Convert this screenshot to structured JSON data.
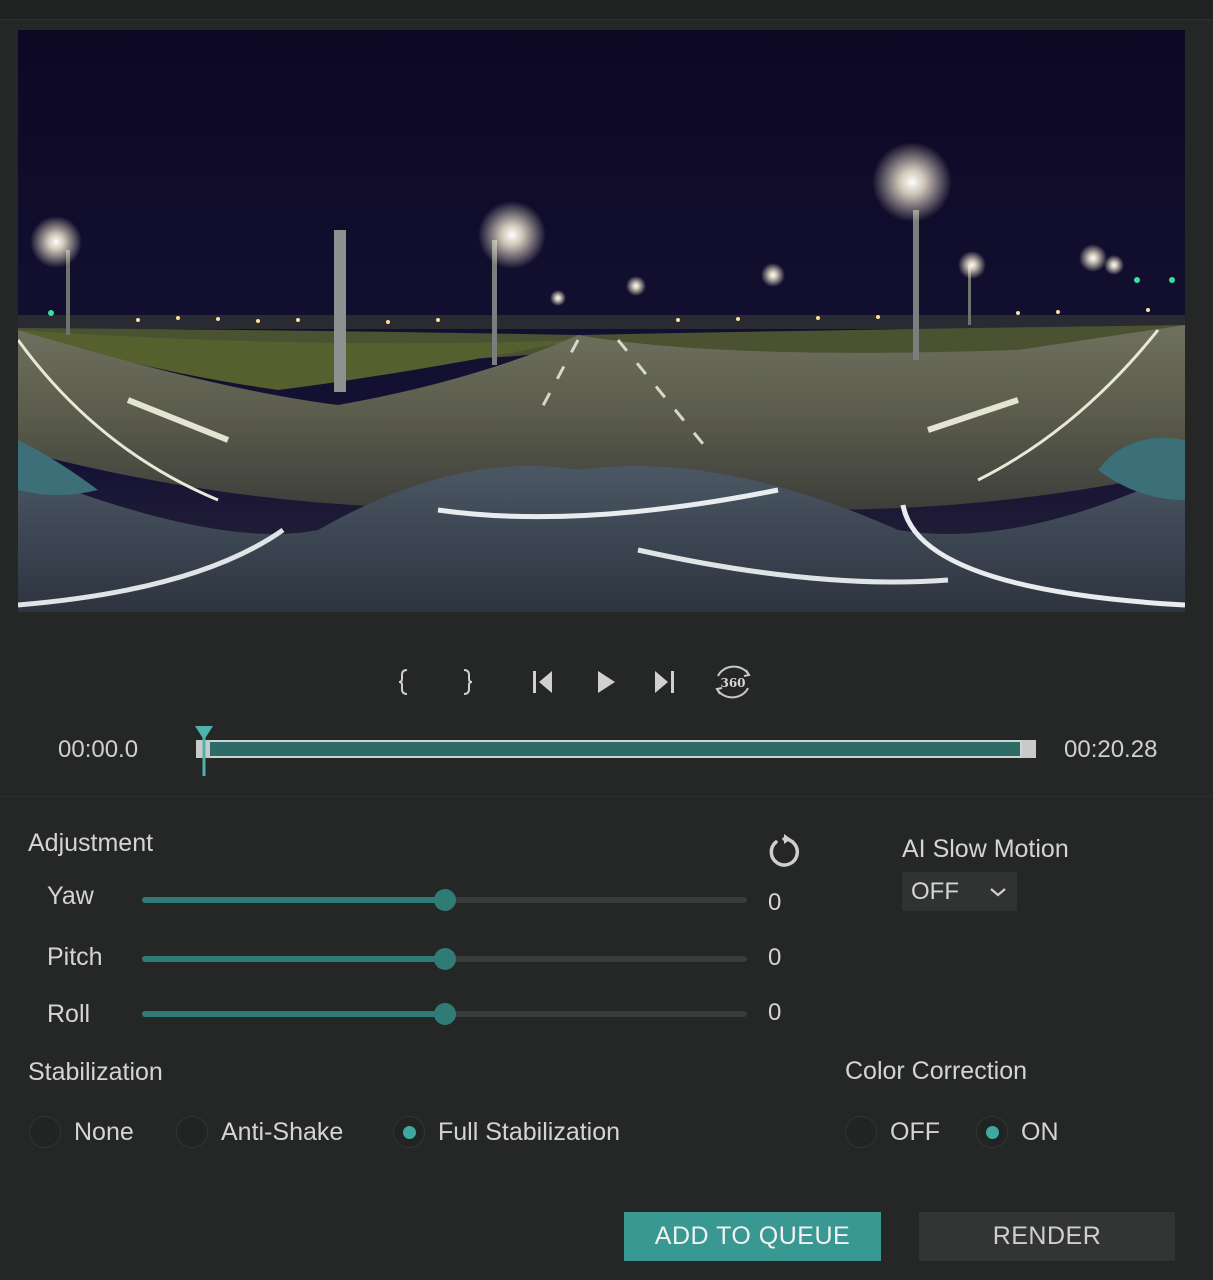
{
  "timeline": {
    "start_time": "00:00.0",
    "end_time": "00:20.28",
    "playhead_position": 0.01
  },
  "controls": {
    "icons": [
      "mark-in-icon",
      "mark-out-icon",
      "skip-back-icon",
      "play-icon",
      "skip-forward-icon",
      "view-360-icon"
    ],
    "view_360_label": "360"
  },
  "adjustment": {
    "title": "Adjustment",
    "sliders": [
      {
        "label": "Yaw",
        "value": "0",
        "level": 0.5
      },
      {
        "label": "Pitch",
        "value": "0",
        "level": 0.5
      },
      {
        "label": "Roll",
        "value": "0",
        "level": 0.5
      }
    ]
  },
  "ai_slow_motion": {
    "title": "AI Slow Motion",
    "selected": "OFF"
  },
  "stabilization": {
    "title": "Stabilization",
    "options": [
      "None",
      "Anti-Shake",
      "Full Stabilization"
    ],
    "selected": "Full Stabilization"
  },
  "color_correction": {
    "title": "Color Correction",
    "options": [
      "OFF",
      "ON"
    ],
    "selected": "ON"
  },
  "buttons": {
    "add_to_queue": "ADD TO QUEUE",
    "render": "RENDER"
  },
  "colors": {
    "accent": "#3a9893",
    "slider_fill": "#2f7b75",
    "background": "#252726"
  }
}
